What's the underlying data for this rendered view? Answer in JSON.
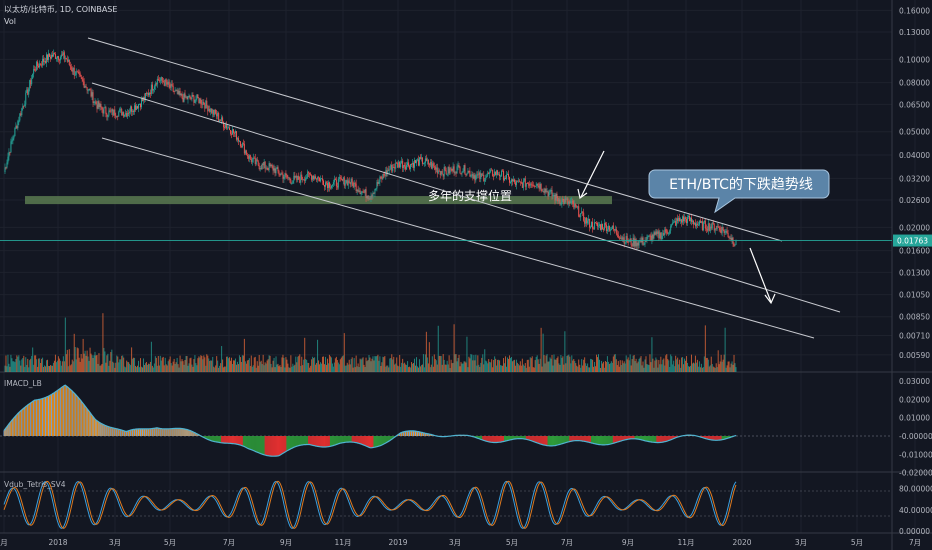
{
  "header": {
    "symbol": "以太坊/比特币, 1D, COINBASE",
    "vol_label": "Vol"
  },
  "price_axis": {
    "ticks": [
      "0.16000",
      "0.13000",
      "0.10000",
      "0.08000",
      "0.06500",
      "0.05000",
      "0.04000",
      "0.03200",
      "0.02600",
      "0.02000",
      "0.01600",
      "0.01300",
      "0.01050",
      "0.00850",
      "0.00710",
      "0.00590"
    ],
    "last_price": "0.01763"
  },
  "macd_axis": {
    "ticks": [
      "0.03000",
      "0.02000",
      "0.01000",
      "-0.00000",
      "-0.01000",
      "-0.02000"
    ]
  },
  "stoch_axis": {
    "ticks": [
      "80.00000",
      "40.00000",
      "0.00000"
    ]
  },
  "time_axis": {
    "ticks": [
      "月",
      "2018",
      "3月",
      "5月",
      "7月",
      "9月",
      "11月",
      "2019",
      "3月",
      "5月",
      "7月",
      "9月",
      "11月",
      "2020",
      "3月",
      "5月",
      "7月"
    ]
  },
  "annotations": {
    "support_label": "多年的支撑位置",
    "callout": "ETH/BTC的下跌趋势线"
  },
  "panes": {
    "macd_title": "IMACD_LB",
    "stoch_title": "Vdub_Tetris_SV4"
  },
  "colors": {
    "background": "#131722",
    "up": "#26a69a",
    "down": "#ef5350",
    "support_zone": "#5a7a50",
    "callout_bg": "#5b84a8"
  },
  "chart_data": {
    "type": "candlestick",
    "title": "以太坊/比特币, 1D, COINBASE",
    "scale": "log",
    "ylim": [
      0.0052,
      0.17
    ],
    "x": [
      "2017-12",
      "2018-01",
      "2018-02",
      "2018-03",
      "2018-04",
      "2018-05",
      "2018-06",
      "2018-07",
      "2018-08",
      "2018-09",
      "2018-10",
      "2018-11",
      "2018-12",
      "2019-01",
      "2019-02",
      "2019-03",
      "2019-04",
      "2019-05",
      "2019-06",
      "2019-07",
      "2019-08",
      "2019-09",
      "2019-10",
      "2019-11",
      "2019-12"
    ],
    "close": [
      0.034,
      0.095,
      0.105,
      0.065,
      0.058,
      0.081,
      0.07,
      0.06,
      0.04,
      0.033,
      0.032,
      0.031,
      0.028,
      0.038,
      0.036,
      0.034,
      0.033,
      0.031,
      0.028,
      0.022,
      0.019,
      0.017,
      0.021,
      0.021,
      0.0176
    ],
    "last_price": 0.01763,
    "support_zone": [
      0.025,
      0.027
    ],
    "macd": [
      0.003,
      0.02,
      0.027,
      0.01,
      0.001,
      0.006,
      0.002,
      -0.002,
      -0.008,
      -0.01,
      -0.005,
      -0.004,
      -0.006,
      0.001,
      0.002,
      -0.001,
      -0.002,
      -0.003,
      -0.004,
      -0.004,
      -0.003,
      -0.003,
      -0.001,
      -0.001,
      -0.0005
    ]
  }
}
